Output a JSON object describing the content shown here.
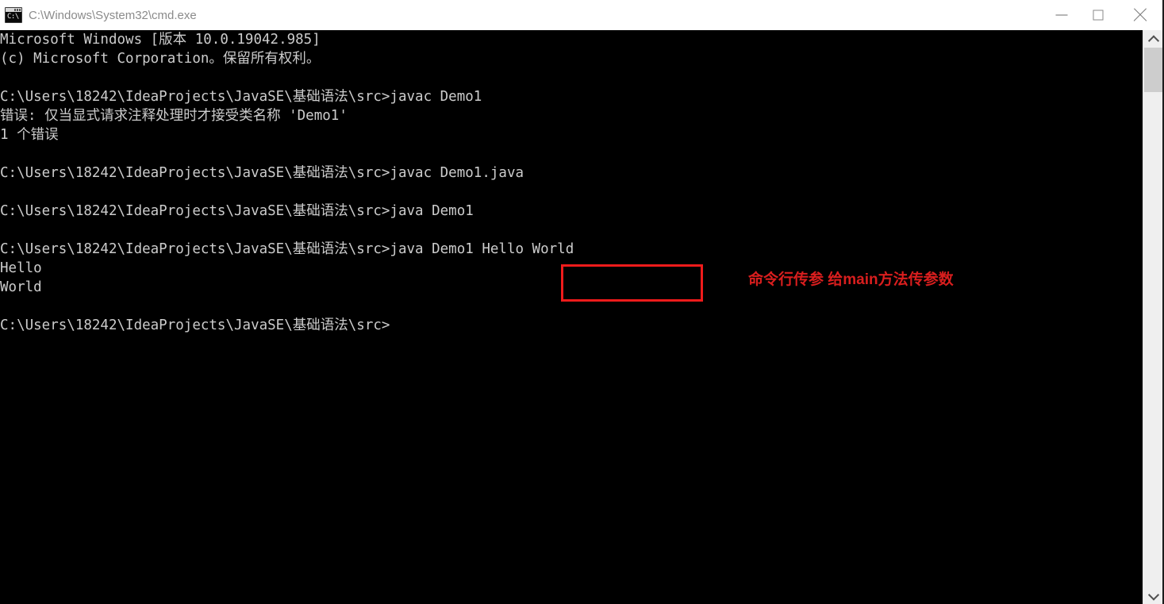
{
  "window": {
    "title": "C:\\Windows\\System32\\cmd.exe",
    "icon": "cmd-icon",
    "icon_glyph": "C:\\",
    "background_color": "#000000",
    "titlebar_color": "#ffffff",
    "text_color": "#cccccc",
    "controls": {
      "minimize_label": "",
      "maximize_label": "",
      "close_label": ""
    }
  },
  "console": {
    "lines": [
      "Microsoft Windows [版本 10.0.19042.985]",
      "(c) Microsoft Corporation。保留所有权利。",
      "",
      "C:\\Users\\18242\\IdeaProjects\\JavaSE\\基础语法\\src>javac Demo1",
      "错误: 仅当显式请求注释处理时才接受类名称 'Demo1'",
      "1 个错误",
      "",
      "C:\\Users\\18242\\IdeaProjects\\JavaSE\\基础语法\\src>javac Demo1.java",
      "",
      "C:\\Users\\18242\\IdeaProjects\\JavaSE\\基础语法\\src>java Demo1",
      "",
      "C:\\Users\\18242\\IdeaProjects\\JavaSE\\基础语法\\src>java Demo1 Hello World",
      "Hello",
      "World",
      "",
      "C:\\Users\\18242\\IdeaProjects\\JavaSE\\基础语法\\src>"
    ],
    "prompt_path": "C:\\Users\\18242\\IdeaProjects\\JavaSE\\基础语法\\src>",
    "highlighted_arguments": "Hello World"
  },
  "annotation": {
    "text": "命令行传参 给main方法传参数",
    "color": "#d91e1e",
    "highlight_box_color": "#ef1b1b"
  },
  "scrollbar": {
    "up_arrow": "chevron-up-icon",
    "down_arrow": "chevron-down-icon",
    "thumb_color": "#cdcdcd",
    "track_color": "#efefef"
  }
}
